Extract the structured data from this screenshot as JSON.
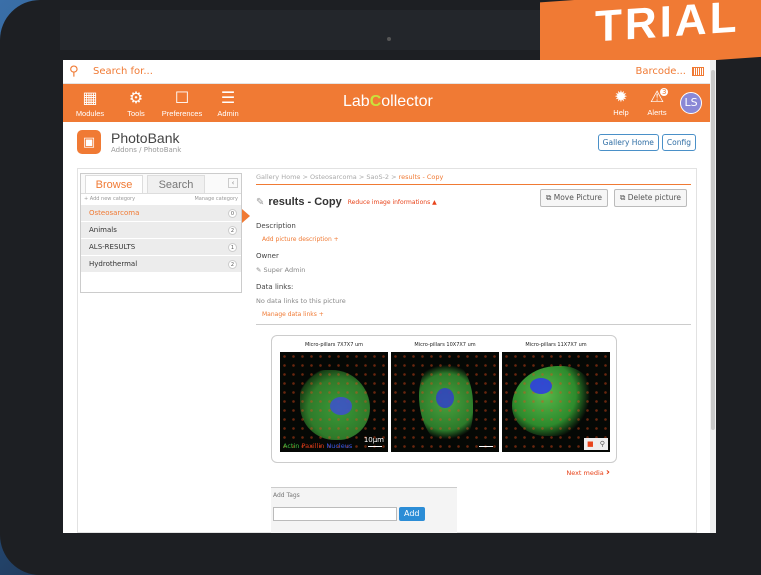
{
  "watermark": "TRIAL",
  "search": {
    "placeholder": "Search for...",
    "barcode_label": "Barcode..."
  },
  "topnav": {
    "items": [
      {
        "label": "Modules",
        "icon": "grid-icon"
      },
      {
        "label": "Tools",
        "icon": "wrench-icon"
      },
      {
        "label": "Preferences",
        "icon": "bookmark-icon"
      },
      {
        "label": "Admin",
        "icon": "sliders-icon"
      }
    ],
    "logo_left": "Lab",
    "logo_c": "C",
    "logo_right": "ollector",
    "help_label": "Help",
    "alerts_label": "Alerts",
    "alerts_count": "3",
    "user_initials": "LS",
    "accent_color": "#f07a34"
  },
  "page": {
    "title": "PhotoBank",
    "breadcrumb": "Addons / PhotoBank",
    "gallery_home_button": "Gallery Home",
    "config_button": "Config"
  },
  "sidebar": {
    "tabs": [
      "Browse",
      "Search"
    ],
    "add_category": "+ Add new category",
    "manage_category": "Manage category",
    "categories": [
      {
        "label": "Osteosarcoma",
        "count": "0"
      },
      {
        "label": "Animals",
        "count": "2"
      },
      {
        "label": "ALS-RESULTS",
        "count": "1"
      },
      {
        "label": "Hydrothermal",
        "count": "2"
      }
    ]
  },
  "main": {
    "breadcrumb_path": "Gallery Home > Osteosarcoma > SaoS-2 > ",
    "breadcrumb_current": "results - Copy",
    "title": "results - Copy",
    "reduce_link": "Reduce image informations ▲",
    "move_button": "Move Picture",
    "delete_button": "Delete picture",
    "description_label": "Description",
    "add_description": "Add picture description +",
    "owner_label": "Owner",
    "owner_value": "Super Admin",
    "datalinks_label": "Data links:",
    "no_datalinks": "No data links to this picture",
    "manage_datalinks": "Manage data links +"
  },
  "gallery": {
    "captions": [
      "Micro-pillars 7X7X7 um",
      "Micro-pillars 10X7X7 um",
      "Micro-pillars 11X7X7 um"
    ],
    "scale_label": "10µm",
    "legend": {
      "actin": "Actin",
      "paxillin": "Paxillin",
      "nucleus": "Nucleus"
    },
    "next_media": "Next media"
  },
  "tags": {
    "label": "Add Tags",
    "add_button": "Add"
  }
}
